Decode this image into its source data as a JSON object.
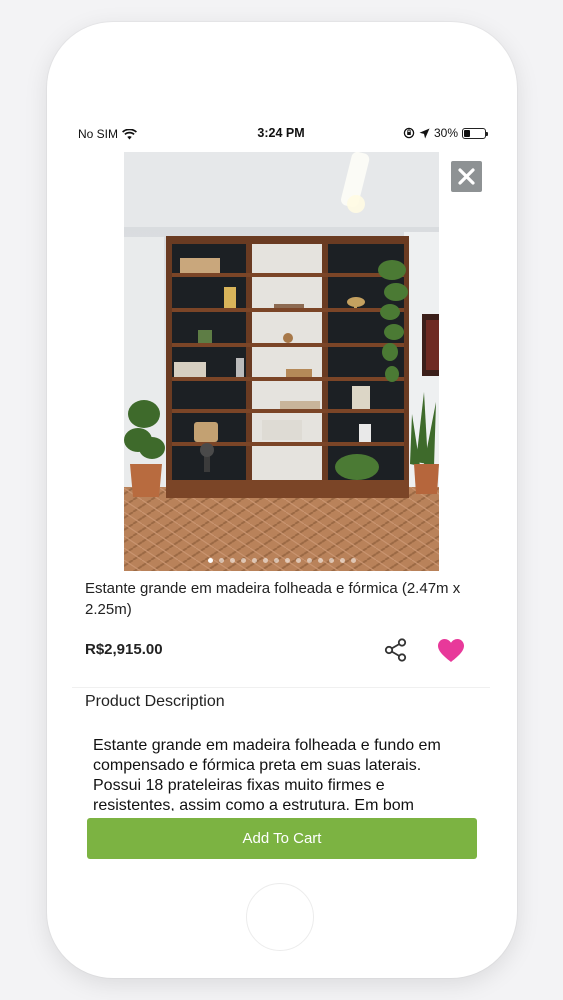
{
  "status_bar": {
    "carrier": "No SIM",
    "time": "3:24 PM",
    "battery_percent": "30%",
    "battery_level": 0.3
  },
  "gallery": {
    "image_count": 14,
    "active_index": 0
  },
  "product": {
    "title": "Estante grande em madeira folheada e fórmica (2.47m x 2.25m)",
    "price": "R$2,915.00",
    "favorited": true
  },
  "description": {
    "heading": "Product Description",
    "text": "Estante grande em madeira folheada e fundo em compensado e fórmica preta em suas laterais. Possui 18 prateleiras fixas muito firmes e resistentes, assim como a estrutura. Em bom"
  },
  "actions": {
    "add_to_cart_label": "Add To Cart"
  },
  "colors": {
    "accent_green": "#7cb342",
    "heart_pink": "#e8399a",
    "close_bg": "#8e9294"
  }
}
